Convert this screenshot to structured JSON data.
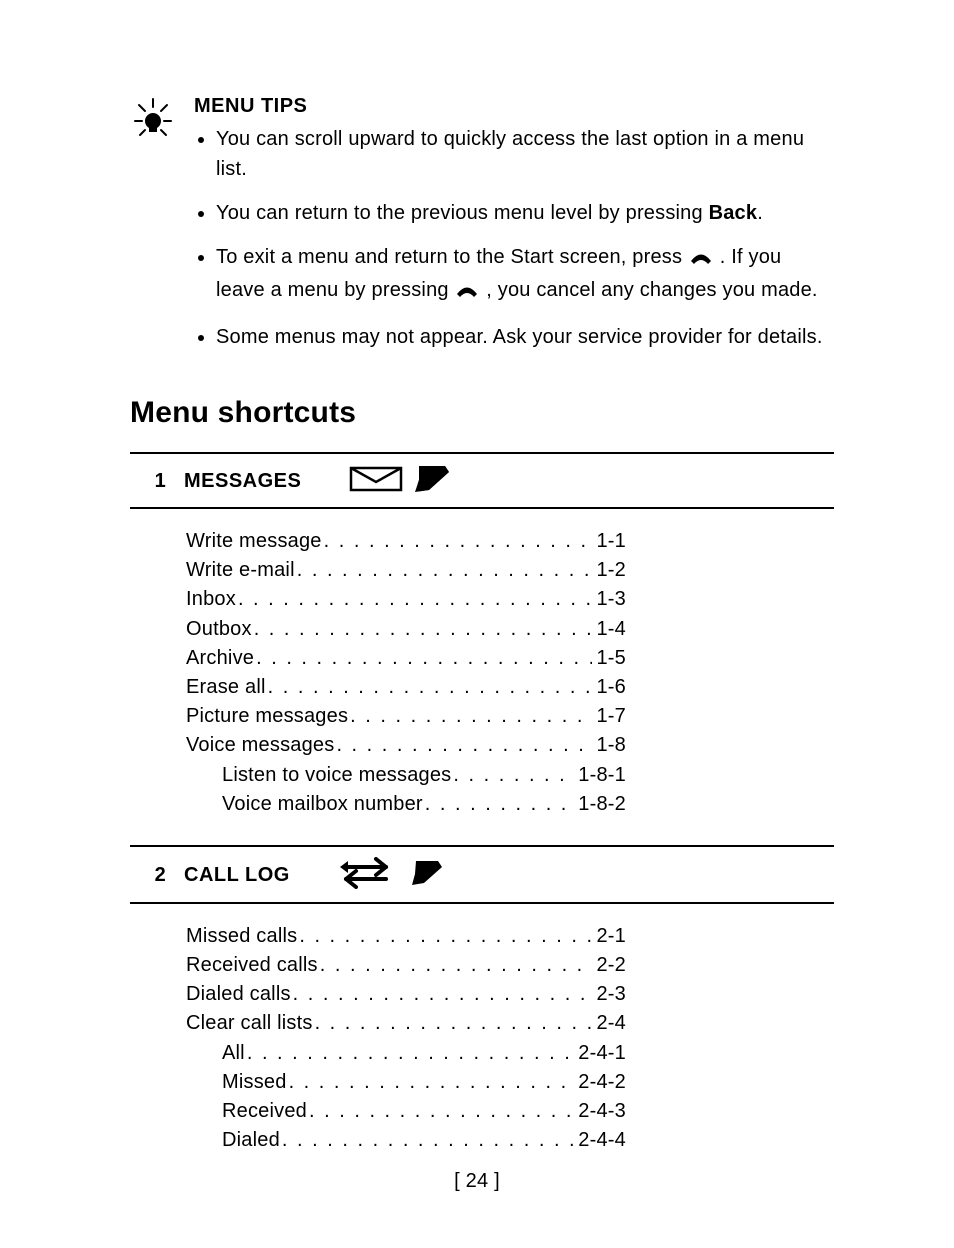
{
  "tips": {
    "title": "MENU TIPS",
    "bullets": [
      {
        "pre": "You can scroll upward to quickly access the last option in a menu list.",
        "bold": "",
        "post": ""
      },
      {
        "pre": "You can return to the previous menu level by pressing ",
        "bold": "Back",
        "post": "."
      },
      {
        "pre": "To exit a menu and return to the Start screen, press ",
        "icon1": true,
        "mid": ". If you leave a menu by pressing ",
        "icon2": true,
        "post": ", you cancel any changes you made."
      },
      {
        "pre": "Some menus may not appear. Ask your service provider for details.",
        "bold": "",
        "post": ""
      }
    ]
  },
  "heading": "Menu shortcuts",
  "section1": {
    "num": "1",
    "title": "MESSAGES",
    "items": [
      {
        "label": "Write message",
        "code": "1-1",
        "indent": false
      },
      {
        "label": "Write e-mail",
        "code": "1-2",
        "indent": false
      },
      {
        "label": "Inbox",
        "code": "1-3",
        "indent": false
      },
      {
        "label": "Outbox",
        "code": "1-4",
        "indent": false
      },
      {
        "label": "Archive",
        "code": "1-5",
        "indent": false
      },
      {
        "label": "Erase all",
        "code": "1-6",
        "indent": false
      },
      {
        "label": "Picture messages",
        "code": "1-7",
        "indent": false
      },
      {
        "label": "Voice messages",
        "code": "1-8",
        "indent": false
      },
      {
        "label": "Listen to voice messages",
        "code": "1-8-1",
        "indent": true
      },
      {
        "label": "Voice mailbox number",
        "code": "1-8-2",
        "indent": true
      }
    ]
  },
  "section2": {
    "num": "2",
    "title": "CALL LOG",
    "items": [
      {
        "label": "Missed calls",
        "code": "2-1",
        "indent": false
      },
      {
        "label": "Received calls",
        "code": "2-2",
        "indent": false
      },
      {
        "label": "Dialed calls",
        "code": "2-3",
        "indent": false
      },
      {
        "label": "Clear call lists",
        "code": "2-4",
        "indent": false
      },
      {
        "label": "All",
        "code": "2-4-1",
        "indent": true
      },
      {
        "label": "Missed",
        "code": "2-4-2",
        "indent": true
      },
      {
        "label": "Received",
        "code": "2-4-3",
        "indent": true
      },
      {
        "label": "Dialed",
        "code": "2-4-4",
        "indent": true
      }
    ]
  },
  "page_number": "[ 24 ]"
}
